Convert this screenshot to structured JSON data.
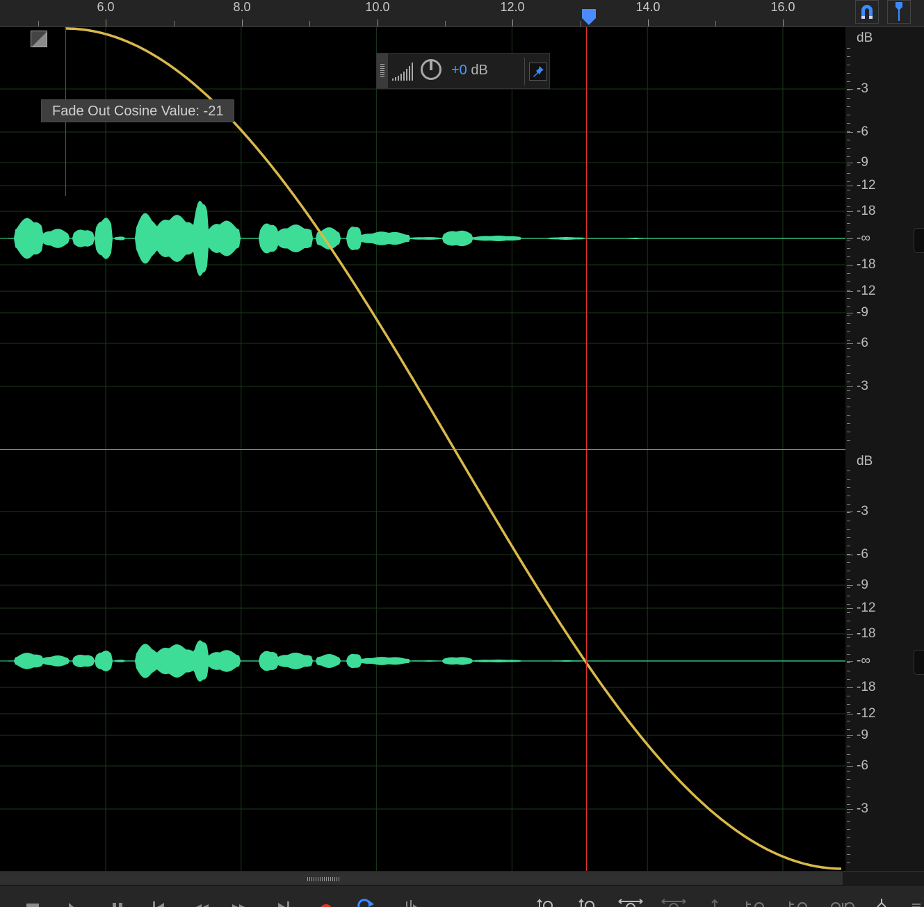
{
  "ruler": {
    "labels": [
      "6.0",
      "8.0",
      "10.0",
      "12.0",
      "14.0",
      "16.0"
    ],
    "label_values": [
      6.0,
      8.0,
      10.0,
      12.0,
      14.0,
      16.0
    ]
  },
  "toolbar": {
    "snap_icon": "magnet-icon",
    "playhead_snap_icon": "playhead-snap-icon"
  },
  "fade": {
    "tooltip": "Fade Out Cosine Value: -21",
    "icon": "fade-handle-icon"
  },
  "hud": {
    "gain_sign": "+0",
    "gain_unit": " dB",
    "knob_icon": "volume-knob-icon",
    "level_icon": "level-meter-icon",
    "pin_icon": "pin-icon"
  },
  "playhead": {
    "time": 13.1,
    "color": "#e0342b"
  },
  "db_scale": {
    "unit": "dB",
    "top_labels": [
      "-3",
      "-6",
      "-9",
      "-12",
      "-18",
      "-∞",
      "-18",
      "-12",
      "-9",
      "-6",
      "-3"
    ]
  },
  "colors": {
    "waveform": "#3ddc97",
    "fade_curve": "#d9b94a",
    "grid": "#1b3a1b",
    "accent": "#4a8cff",
    "record": "#e0342b"
  },
  "transport": {
    "buttons": [
      "stop-icon",
      "play-icon",
      "pause-icon",
      "go-to-start-icon",
      "rewind-icon",
      "fast-forward-icon",
      "go-to-end-icon",
      "record-icon",
      "loop-icon",
      "skip-selection-icon",
      "zoom-in-amplitude-icon",
      "zoom-out-amplitude-icon",
      "zoom-in-time-icon",
      "zoom-out-time-icon",
      "zoom-full-icon",
      "zoom-in-selection-icon",
      "zoom-out-selection-icon",
      "zoom-in-channel-icon",
      "zoom-in-point-icon"
    ]
  }
}
